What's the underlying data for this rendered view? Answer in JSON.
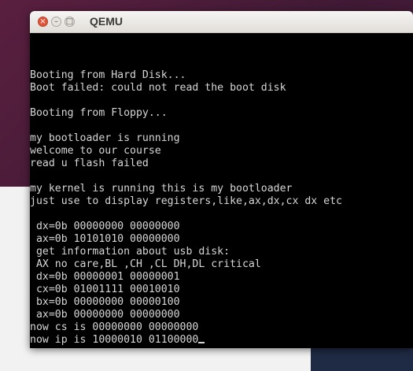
{
  "window": {
    "title": "QEMU"
  },
  "titlebar_buttons": {
    "close": "×",
    "minimize": "–",
    "maximize": "□"
  },
  "console": {
    "lines": [
      "Booting from Hard Disk...",
      "Boot failed: could not read the boot disk",
      "",
      "Booting from Floppy...",
      "",
      "my bootloader is running",
      "welcome to our course",
      "read u flash failed",
      "",
      "my kernel is running this is my bootloader",
      "just use to display registers,like,ax,dx,cx dx etc",
      "",
      " dx=0b 00000000 00000000",
      " ax=0b 10101010 00000000",
      " get information about usb disk:",
      " AX no care,BL ,CH ,CL DH,DL critical",
      " dx=0b 00000001 00000001",
      " cx=0b 01001111 00010010",
      " bx=0b 00000000 00000100",
      " ax=0b 00000000 00000000",
      "now cs is 00000000 00000000",
      "now ip is 10000010 01100000"
    ]
  }
}
